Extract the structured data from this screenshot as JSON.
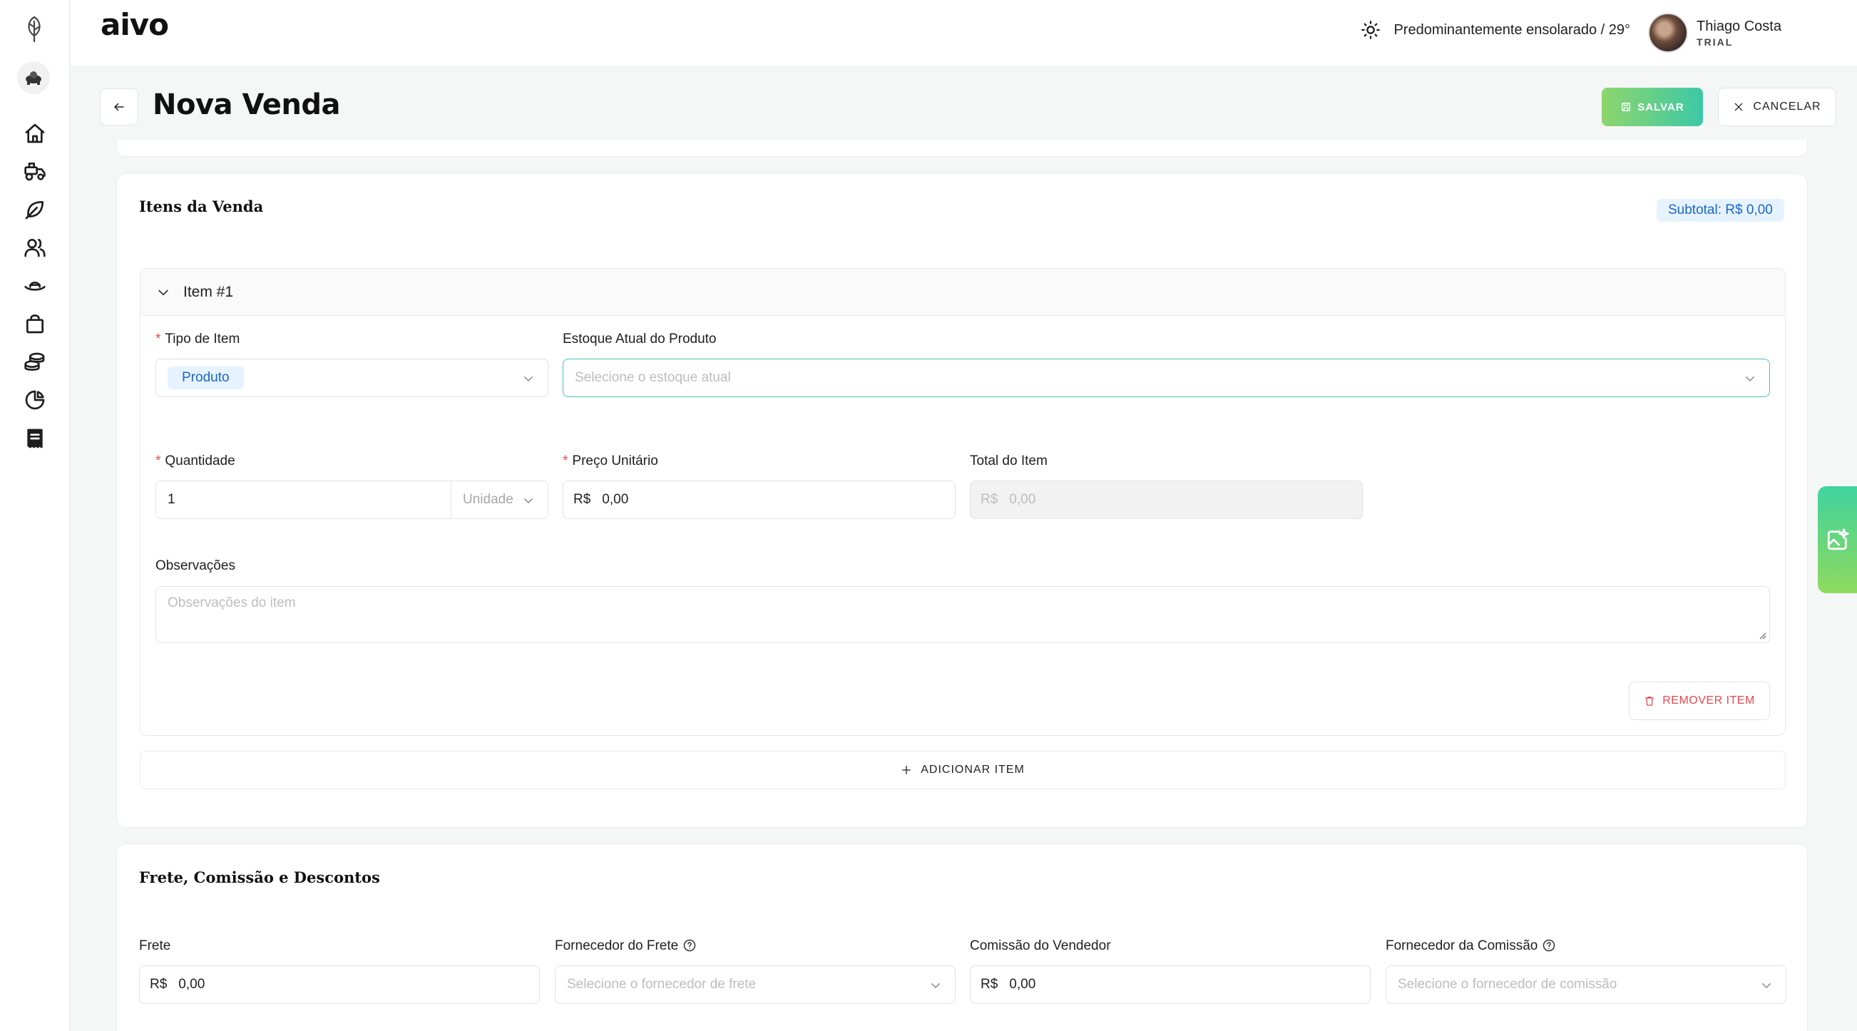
{
  "app": {
    "brand": "aivo"
  },
  "header": {
    "weather": "Predominantemente ensolarado / 29°",
    "user_name": "Thiago Costa",
    "user_plan": "TRIAL"
  },
  "page": {
    "title": "Nova Venda",
    "save_label": "SALVAR",
    "cancel_label": "CANCELAR"
  },
  "sidebar": {
    "icons": [
      "plant-logo-icon",
      "farm-avatar-icon",
      "home-icon",
      "tractor-icon",
      "leaf-icon",
      "users-icon",
      "hat-icon",
      "shopping-bag-icon",
      "coins-icon",
      "pie-chart-icon",
      "receipt-icon"
    ]
  },
  "items_section": {
    "title": "Itens da Venda",
    "subtotal": "Subtotal: R$ 0,00",
    "item": {
      "title": "Item #1",
      "tipo_label": "Tipo de Item",
      "tipo_value": "Produto",
      "estoque_label": "Estoque Atual do Produto",
      "estoque_placeholder": "Selecione o estoque atual",
      "quantidade_label": "Quantidade",
      "quantidade_value": "1",
      "unidade_placeholder": "Unidade",
      "preco_label": "Preço Unitário",
      "preco_prefix": "R$",
      "preco_value": "0,00",
      "total_label": "Total do Item",
      "total_prefix": "R$",
      "total_value": "0,00",
      "obs_label": "Observações",
      "obs_placeholder": "Observações do item",
      "remove_label": "REMOVER ITEM"
    },
    "add_label": "ADICIONAR ITEM"
  },
  "freight_section": {
    "title": "Frete, Comissão e Descontos",
    "frete_label": "Frete",
    "frete_prefix": "R$",
    "frete_value": "0,00",
    "fornecedor_frete_label": "Fornecedor do Frete",
    "fornecedor_frete_placeholder": "Selecione o fornecedor de frete",
    "comissao_label": "Comissão do Vendedor",
    "comissao_prefix": "R$",
    "comissao_value": "0,00",
    "fornecedor_comissao_label": "Fornecedor da Comissão",
    "fornecedor_comissao_placeholder": "Selecione o fornecedor de comissão"
  }
}
